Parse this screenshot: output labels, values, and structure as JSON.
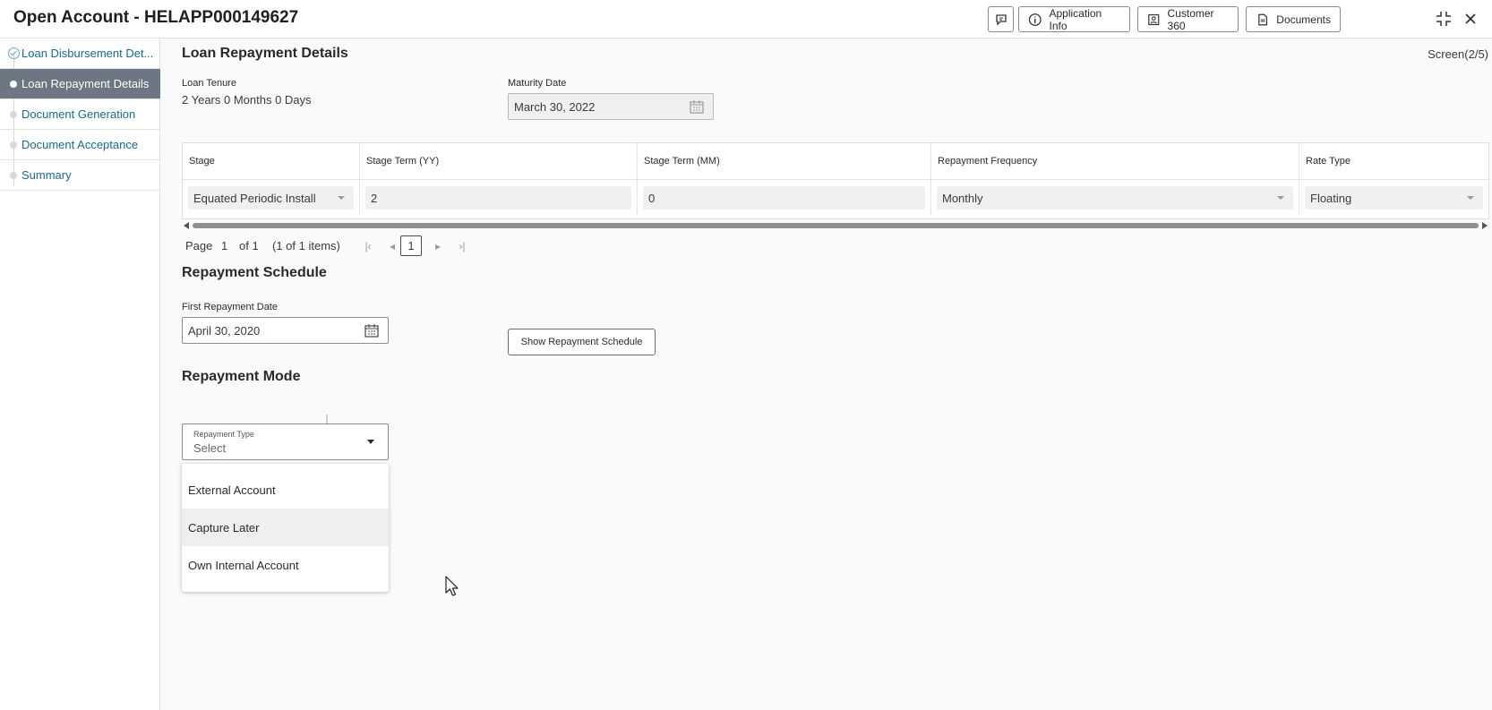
{
  "header": {
    "title": "Open Account - HELAPP000149627",
    "buttons": {
      "application_info": "Application Info",
      "customer_360": "Customer 360",
      "documents": "Documents"
    }
  },
  "sidebar": {
    "items": [
      {
        "label": "Loan Disbursement Det...",
        "state": "completed"
      },
      {
        "label": "Loan Repayment Details",
        "state": "active"
      },
      {
        "label": "Document Generation",
        "state": "pending"
      },
      {
        "label": "Document Acceptance",
        "state": "pending"
      },
      {
        "label": "Summary",
        "state": "pending"
      }
    ]
  },
  "main": {
    "section_title": "Loan Repayment Details",
    "screen_indicator": "Screen(2/5)",
    "loan_tenure": {
      "label": "Loan Tenure",
      "value": "2 Years 0 Months 0 Days"
    },
    "maturity_date": {
      "label": "Maturity Date",
      "value": "March 30, 2022"
    },
    "table": {
      "columns": [
        "Stage",
        "Stage Term (YY)",
        "Stage Term (MM)",
        "Repayment Frequency",
        "Rate Type"
      ],
      "rows": [
        [
          "Equated Periodic Install",
          "2",
          "0",
          "Monthly",
          "Floating"
        ]
      ]
    },
    "pager": {
      "page_label": "Page",
      "page_value": "1",
      "of_label": "of 1",
      "items_label": "(1 of 1 items)",
      "current": "1"
    },
    "repayment_schedule": {
      "title": "Repayment Schedule",
      "first_date_label": "First Repayment Date",
      "first_date_value": "April 30, 2020",
      "show_button": "Show Repayment Schedule"
    },
    "repayment_mode": {
      "title": "Repayment Mode",
      "type_label": "Repayment Type",
      "type_value": "Select",
      "options": [
        "External Account",
        "Capture Later",
        "Own Internal Account"
      ],
      "hovered_option": "Capture Later"
    }
  },
  "colors": {
    "active_nav_bg": "#6c7783",
    "nav_link": "#1a6a8a",
    "page_bg": "#fafafa"
  }
}
